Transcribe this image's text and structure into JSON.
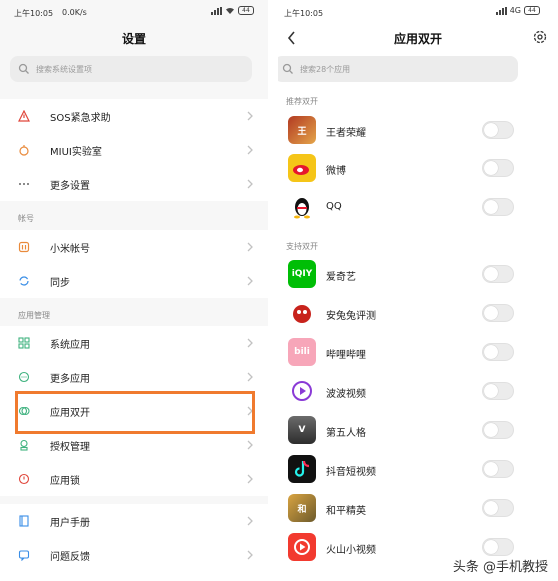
{
  "left_screen": {
    "status": {
      "time": "上午10:05",
      "network_speed": "0.0K/s",
      "battery": "44"
    },
    "title": "设置",
    "search": {
      "placeholder": "搜索系统设置项"
    },
    "group1": [
      {
        "label": "SOS紧急求助",
        "icon": "sos-warning-icon"
      },
      {
        "label": "MIUI实验室",
        "icon": "lab-flask-icon"
      },
      {
        "label": "更多设置",
        "icon": "more-dots-icon"
      }
    ],
    "section_account": "帐号",
    "group2": [
      {
        "label": "小米帐号",
        "icon": "mi-account-icon"
      },
      {
        "label": "同步",
        "icon": "sync-icon"
      }
    ],
    "section_apps": "应用管理",
    "group3": [
      {
        "label": "系统应用",
        "icon": "grid-apps-icon"
      },
      {
        "label": "更多应用",
        "icon": "more-apps-icon"
      },
      {
        "label": "应用双开",
        "icon": "dual-apps-icon"
      },
      {
        "label": "授权管理",
        "icon": "permission-icon"
      },
      {
        "label": "应用锁",
        "icon": "app-lock-icon"
      }
    ],
    "group4": [
      {
        "label": "用户手册",
        "icon": "manual-book-icon"
      },
      {
        "label": "问题反馈",
        "icon": "feedback-icon"
      }
    ],
    "colors": {
      "highlight": "#f07a2e"
    }
  },
  "right_screen": {
    "status": {
      "time": "上午10:05",
      "network": "4G",
      "battery": "44"
    },
    "title": "应用双开",
    "search": {
      "placeholder": "搜索28个应用"
    },
    "section_recommended": "推荐双开",
    "recommended": [
      {
        "name": "王者荣耀",
        "icon": "honor-of-kings-icon",
        "enabled": false
      },
      {
        "name": "微博",
        "icon": "weibo-icon",
        "enabled": false
      },
      {
        "name": "QQ",
        "icon": "qq-penguin-icon",
        "enabled": false
      }
    ],
    "section_supported": "支持双开",
    "supported": [
      {
        "name": "爱奇艺",
        "icon": "iqiyi-icon",
        "enabled": false
      },
      {
        "name": "安兔兔评测",
        "icon": "antutu-icon",
        "enabled": false
      },
      {
        "name": "哔哩哔哩",
        "icon": "bilibili-icon",
        "enabled": false
      },
      {
        "name": "波波视频",
        "icon": "bobo-video-icon",
        "enabled": false
      },
      {
        "name": "第五人格",
        "icon": "identity-v-icon",
        "enabled": false
      },
      {
        "name": "抖音短视频",
        "icon": "douyin-icon",
        "enabled": false
      },
      {
        "name": "和平精英",
        "icon": "peace-elite-icon",
        "enabled": false
      },
      {
        "name": "火山小视频",
        "icon": "huoshan-video-icon",
        "enabled": false
      }
    ]
  },
  "watermark": "头条 @手机教授"
}
